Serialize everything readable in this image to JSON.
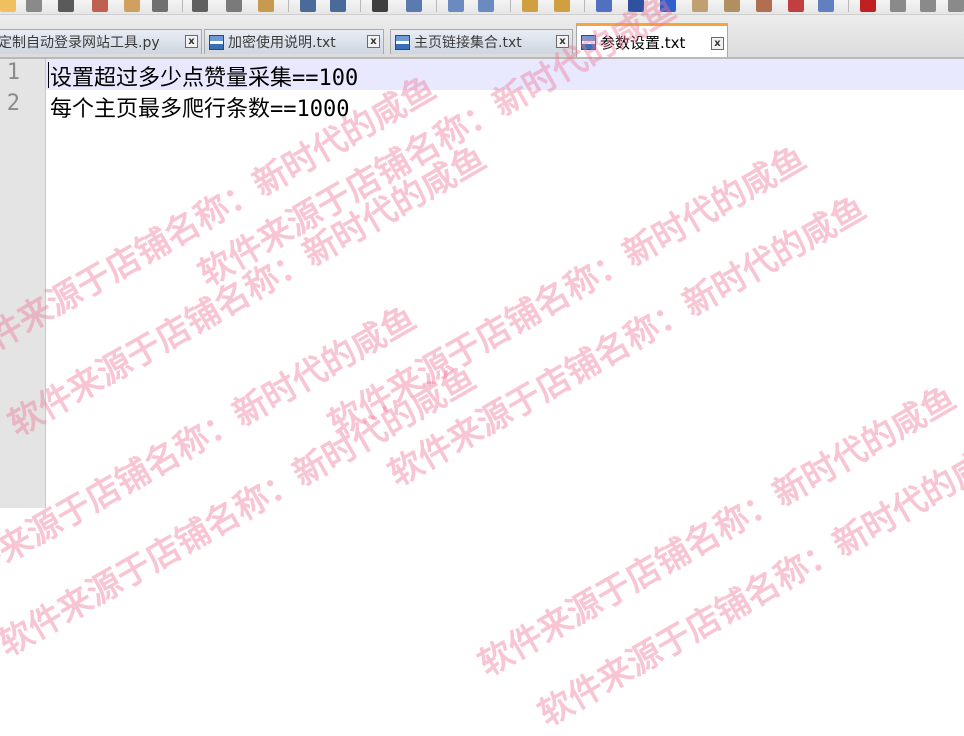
{
  "toolbar": {
    "colors": {
      "background": "#e6e6e6"
    }
  },
  "tabs": [
    {
      "label": "定制自动登录网站工具.py",
      "active": false
    },
    {
      "label": "加密使用说明.txt",
      "active": false
    },
    {
      "label": "主页链接集合.txt",
      "active": false
    },
    {
      "label": "参数设置.txt",
      "active": true
    }
  ],
  "editor": {
    "lines": [
      {
        "number": "1",
        "text": "设置超过多少点赞量采集==100"
      },
      {
        "number": "2",
        "text": "每个主页最多爬行条数==1000"
      }
    ],
    "colors": {
      "current_line": "#e8e8ff",
      "gutter": "#e4e4e4",
      "active_tab_accent": "#f7a53a"
    }
  },
  "watermark": {
    "store_text": "软件来源于店铺名称：新时代的咸鱼",
    "color": "#ee7896"
  }
}
